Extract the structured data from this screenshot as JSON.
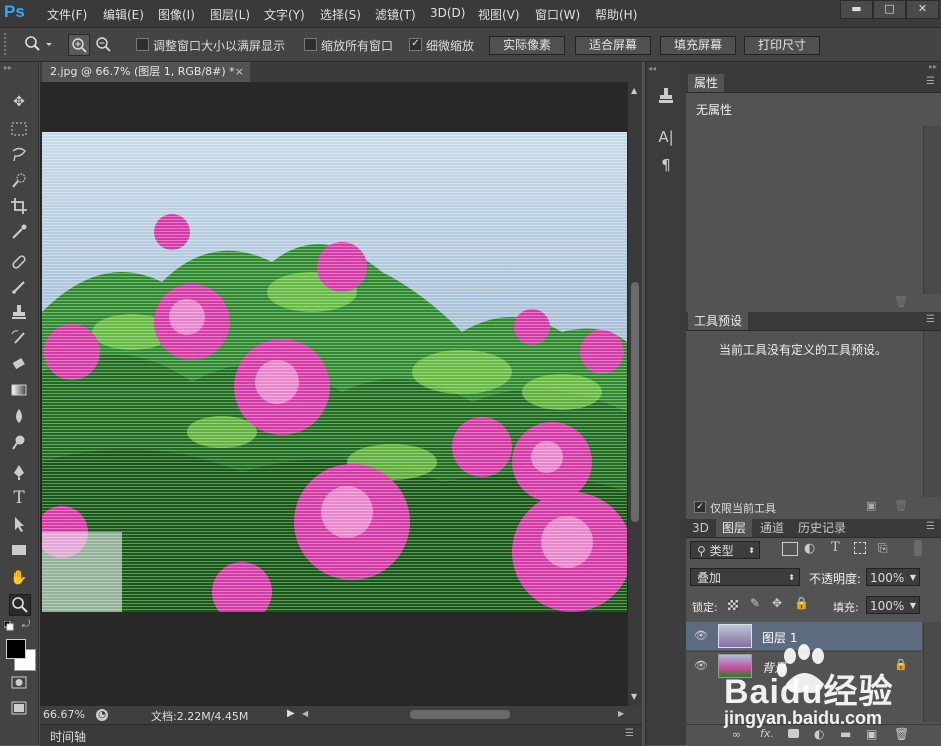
{
  "app": {
    "logo": "Ps"
  },
  "menu": [
    {
      "label": "文件(F)"
    },
    {
      "label": "编辑(E)"
    },
    {
      "label": "图像(I)"
    },
    {
      "label": "图层(L)"
    },
    {
      "label": "文字(Y)"
    },
    {
      "label": "选择(S)"
    },
    {
      "label": "滤镜(T)"
    },
    {
      "label": "3D(D)"
    },
    {
      "label": "视图(V)"
    },
    {
      "label": "窗口(W)"
    },
    {
      "label": "帮助(H)"
    }
  ],
  "window_controls": {
    "minimize": "▬",
    "maximize": "□",
    "close": "✕"
  },
  "options": {
    "resize_windows": "调整窗口大小以满屏显示",
    "zoom_all_windows": "缩放所有窗口",
    "scrubby_zoom": "细微缩放",
    "resize_checked": false,
    "zoom_all_checked": false,
    "scrubby_checked": true,
    "btn_actual_pixels": "实际像素",
    "btn_fit_screen": "适合屏幕",
    "btn_fill_screen": "填充屏幕",
    "btn_print_size": "打印尺寸"
  },
  "document": {
    "tab_title": "2.jpg @ 66.7% (图层 1, RGB/8#) *",
    "close_symbol": "×",
    "zoom": "66.67%",
    "doc_info": "文档:2.22M/4.45M"
  },
  "timeline": {
    "label": "时间轴"
  },
  "properties_panel": {
    "tab": "属性",
    "content": "无属性"
  },
  "tool_presets_panel": {
    "tab": "工具预设",
    "content": "当前工具没有定义的工具预设。",
    "current_tool_only": "仅限当前工具",
    "current_tool_only_checked": true
  },
  "layers_panel": {
    "tabs": [
      "3D",
      "图层",
      "通道",
      "历史记录"
    ],
    "active_tab": "图层",
    "filter_kind": "类型",
    "blend_mode": "叠加",
    "opacity_label": "不透明度:",
    "opacity_value": "100%",
    "lock_label": "锁定:",
    "fill_label": "填充:",
    "fill_value": "100%",
    "layers": [
      {
        "name": "图层 1",
        "selected": true,
        "locked": false
      },
      {
        "name": "背景",
        "selected": false,
        "locked": true
      }
    ],
    "footer_fx": "fx."
  },
  "watermark": {
    "brand": "Baidu经验",
    "url": "jingyan.baidu.com"
  },
  "colors": {
    "ui_dark": "#3a3a3a",
    "ui_mid": "#535353",
    "layer_selected": "#5d6b81",
    "ps_blue": "#31a8ff",
    "foreground": "#000000",
    "background": "#ffffff"
  }
}
